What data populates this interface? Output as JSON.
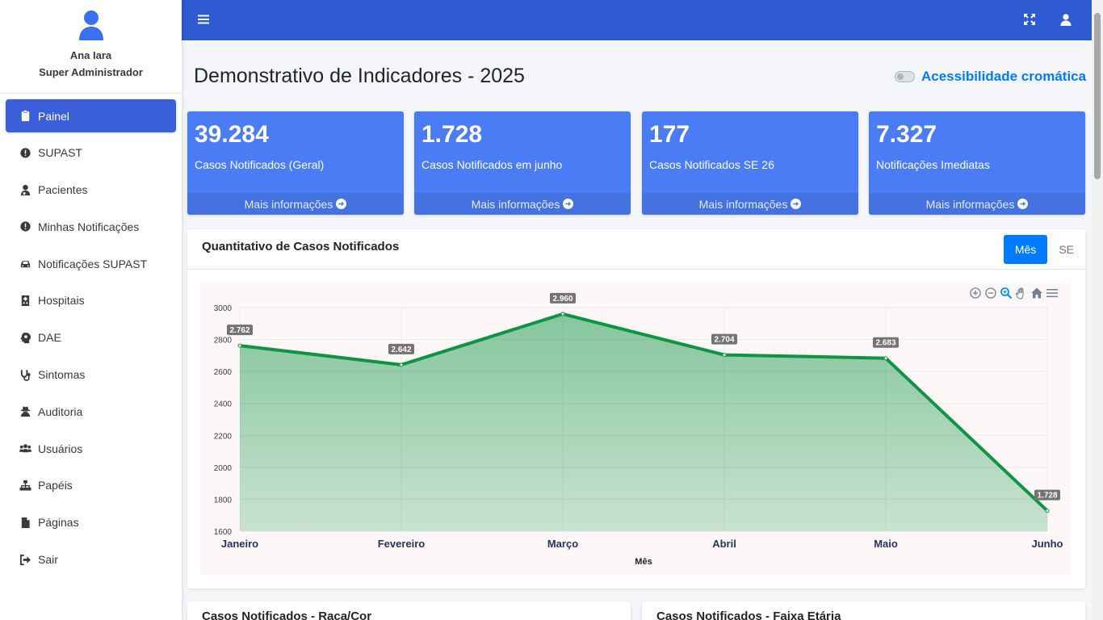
{
  "user": {
    "name": "Ana Iara",
    "role": "Super Administrador"
  },
  "sidebar": {
    "items": [
      {
        "label": "Painel",
        "icon": "clipboard-icon",
        "active": true
      },
      {
        "label": "SUPAST",
        "icon": "exclamation-circle-icon"
      },
      {
        "label": "Pacientes",
        "icon": "user-injured-icon"
      },
      {
        "label": "Minhas Notificações",
        "icon": "exclamation-circle-icon"
      },
      {
        "label": "Notificações SUPAST",
        "icon": "car-icon"
      },
      {
        "label": "Hospitais",
        "icon": "hospital-icon"
      },
      {
        "label": "DAE",
        "icon": "head-virus-icon"
      },
      {
        "label": "Sintomas",
        "icon": "stethoscope-icon"
      },
      {
        "label": "Auditoria",
        "icon": "user-secret-icon"
      },
      {
        "label": "Usuários",
        "icon": "users-icon"
      },
      {
        "label": "Papéis",
        "icon": "sitemap-icon"
      },
      {
        "label": "Páginas",
        "icon": "file-icon"
      },
      {
        "label": "Sair",
        "icon": "sign-out-icon"
      }
    ]
  },
  "topbar": {
    "menu_icon": "bars-icon",
    "fullscreen_icon": "expand-icon",
    "user_icon": "user-icon"
  },
  "page": {
    "title": "Demonstrativo de Indicadores - 2025",
    "accessibility_label": "Acessibilidade cromática"
  },
  "stats": [
    {
      "value": "39.284",
      "label": "Casos Notificados (Geral)",
      "more": "Mais informações"
    },
    {
      "value": "1.728",
      "label": "Casos Notificados em junho",
      "more": "Mais informações"
    },
    {
      "value": "177",
      "label": "Casos Notificados SE 26",
      "more": "Mais informações"
    },
    {
      "value": "7.327",
      "label": "Notificações Imediatas",
      "more": "Mais informações"
    }
  ],
  "colors": {
    "topbar": "#2d59d1",
    "stat_box": "#4a7cf5",
    "accent": "#007bff",
    "series": "#0e9444"
  },
  "chart_card": {
    "title": "Quantitativo de Casos Notificados",
    "toggle": {
      "month_label": "Mês",
      "se_label": "SE"
    }
  },
  "chart_data": {
    "type": "area",
    "categories": [
      "Janeiro",
      "Fevereiro",
      "Março",
      "Abril",
      "Maio",
      "Junho"
    ],
    "values": [
      2762,
      2642,
      2960,
      2704,
      2683,
      1728
    ],
    "data_labels": [
      "2.762",
      "2.642",
      "2.960",
      "2.704",
      "2.683",
      "1.728"
    ],
    "xlabel": "Mês",
    "ylabel": "",
    "ylim": [
      1600,
      3000
    ],
    "yticks": [
      1600,
      1800,
      2000,
      2200,
      2400,
      2600,
      2800,
      3000
    ],
    "grid": true,
    "legend": "none"
  },
  "bottom_cards": [
    {
      "title": "Casos Notificados - Raça/Cor"
    },
    {
      "title": "Casos Notificados - Faixa Etária"
    }
  ]
}
